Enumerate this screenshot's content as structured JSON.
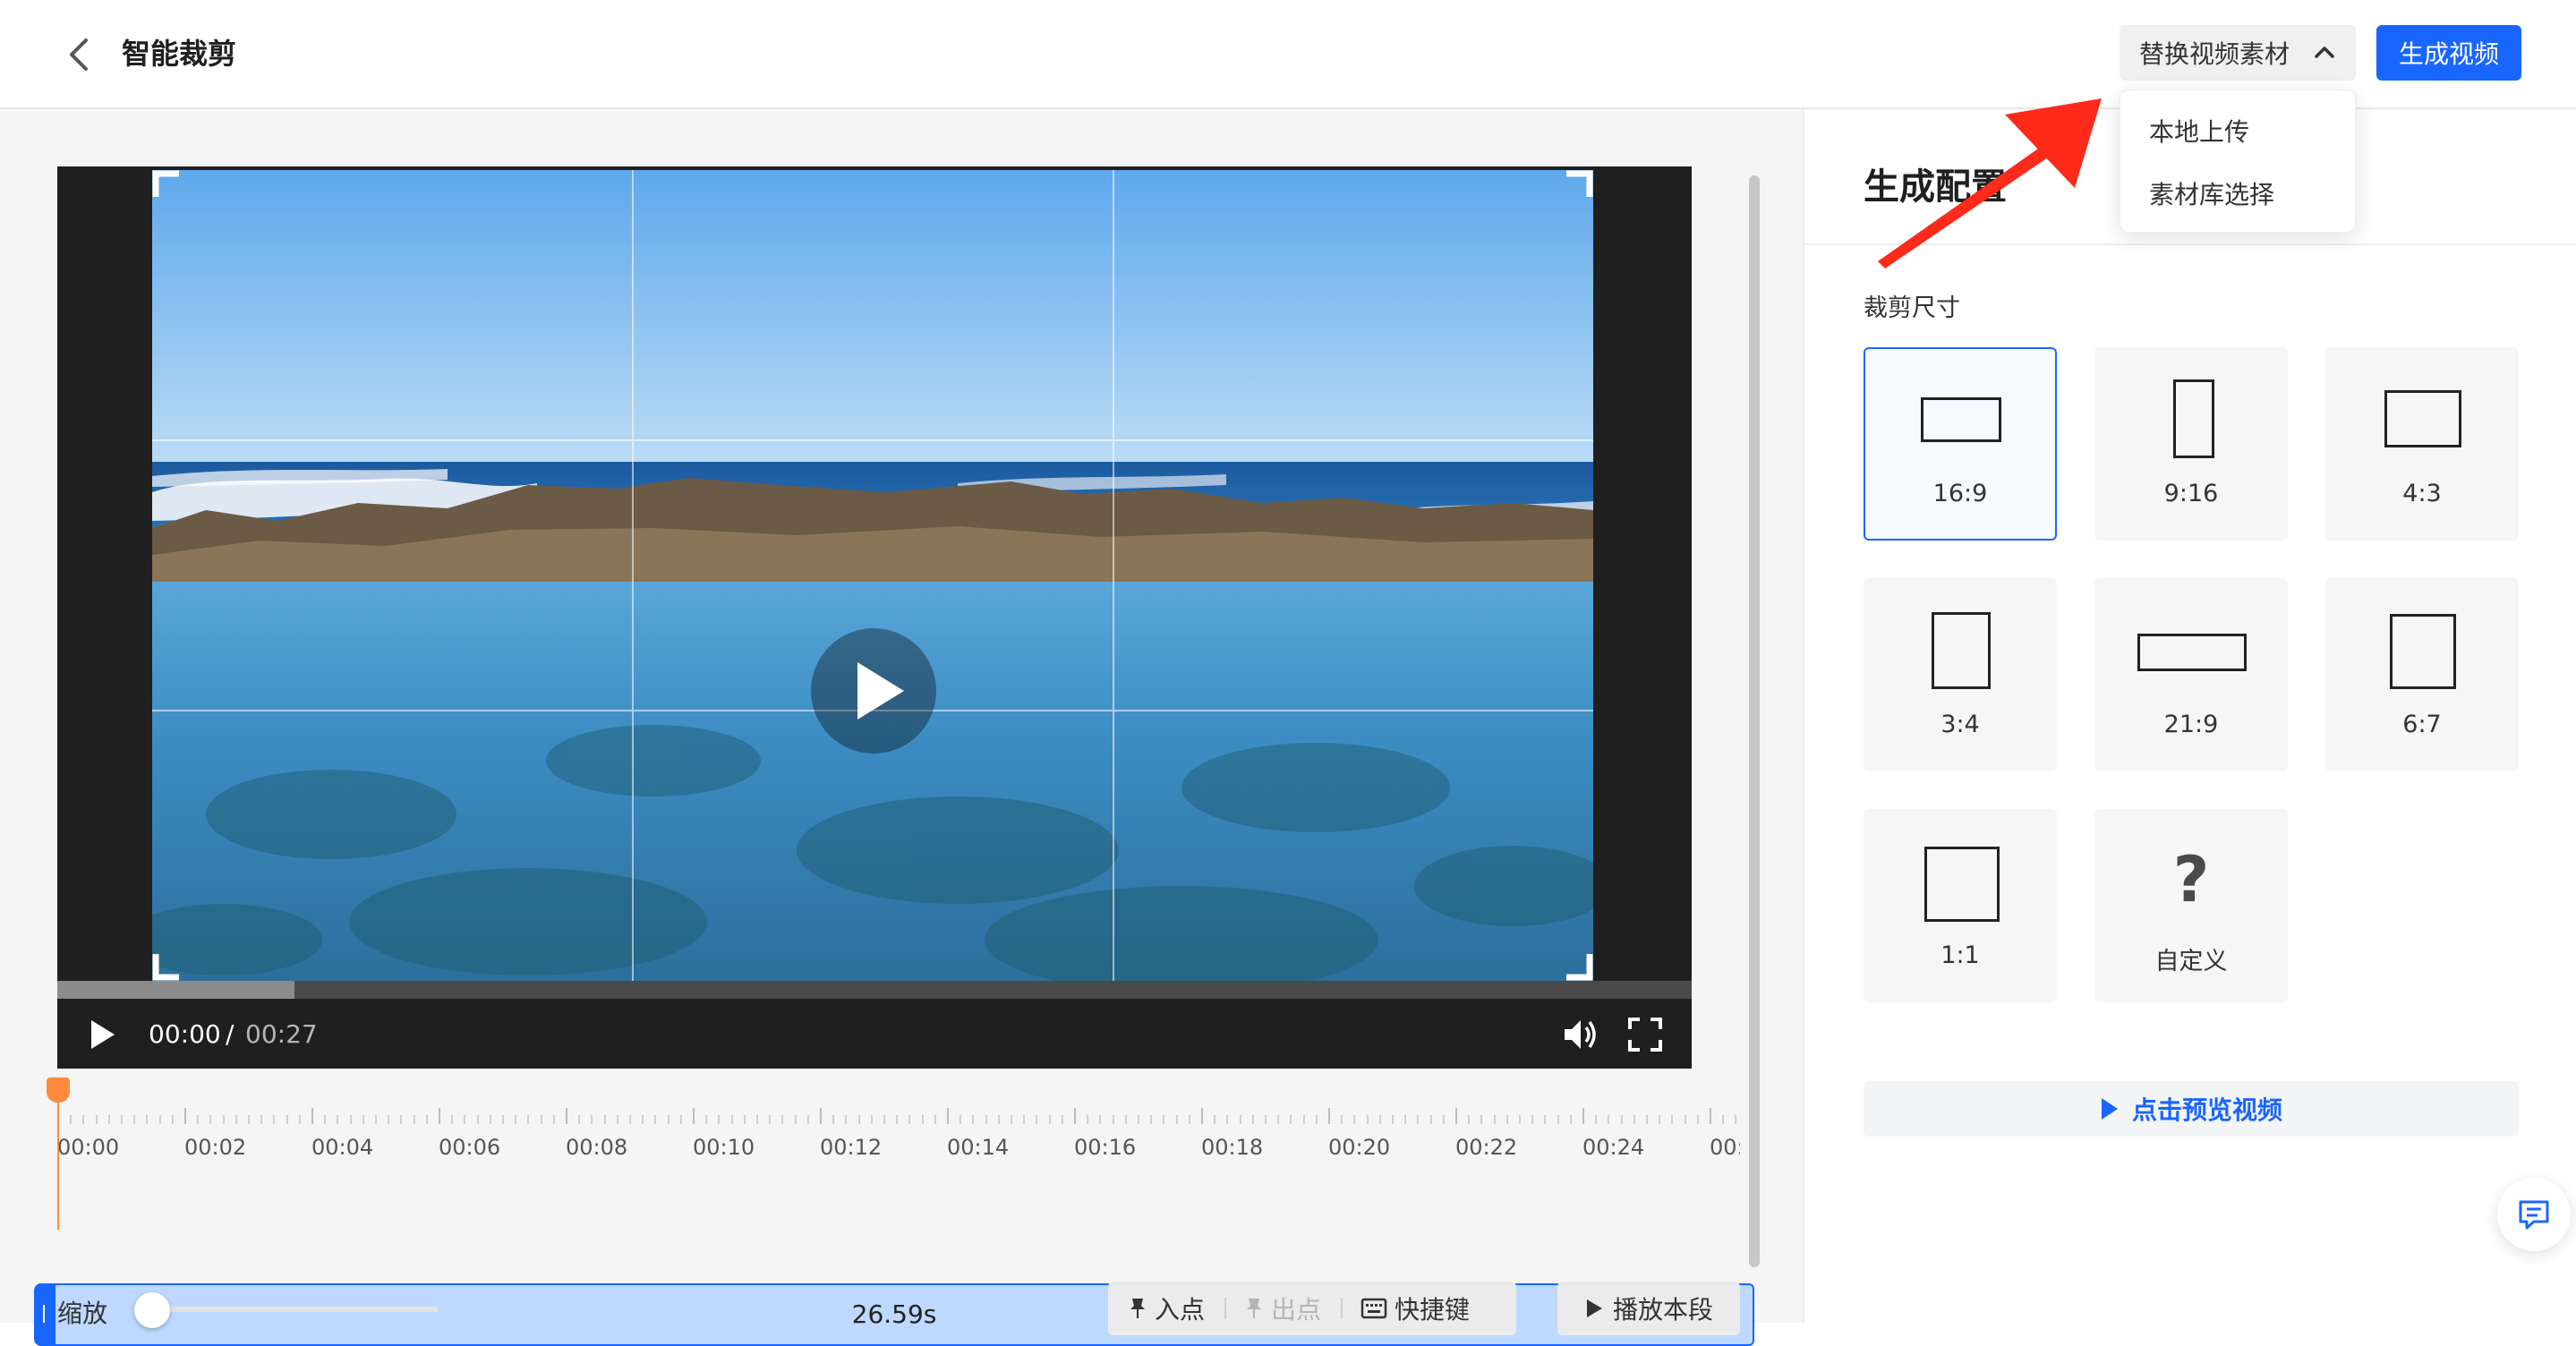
{
  "header": {
    "title": "智能裁剪",
    "replace_label": "替换视频素材",
    "generate_label": "生成视频",
    "dropdown_items": [
      "本地上传",
      "素材库选择"
    ]
  },
  "player": {
    "time_current": "00:00",
    "time_separator": "/",
    "time_total": "00:27",
    "buffered_fraction": 0.145
  },
  "timeline": {
    "tick_labels": [
      "00:00",
      "00:02",
      "00:04",
      "00:06",
      "00:08",
      "00:10",
      "00:12",
      "00:14",
      "00:16",
      "00:18",
      "00:20",
      "00:22",
      "00:24",
      "00:"
    ],
    "clip_duration": "26.59s"
  },
  "toolbar": {
    "zoom_label": "缩放",
    "in_point_label": "入点",
    "out_point_label": "出点",
    "shortcut_label": "快捷键",
    "play_segment_label": "播放本段"
  },
  "panel": {
    "title": "生成配置",
    "crop_size_label": "裁剪尺寸",
    "ratios": [
      {
        "label": "16:9",
        "selected": true
      },
      {
        "label": "9:16",
        "selected": false
      },
      {
        "label": "4:3",
        "selected": false
      },
      {
        "label": "3:4",
        "selected": false
      },
      {
        "label": "21:9",
        "selected": false
      },
      {
        "label": "6:7",
        "selected": false
      },
      {
        "label": "1:1",
        "selected": false
      },
      {
        "label": "自定义",
        "selected": false
      }
    ],
    "custom_symbol": "?",
    "preview_label": "点击预览视频"
  },
  "colors": {
    "accent": "#1966ff",
    "playhead": "#ff8a3d",
    "annotation": "#ff2a1a"
  }
}
